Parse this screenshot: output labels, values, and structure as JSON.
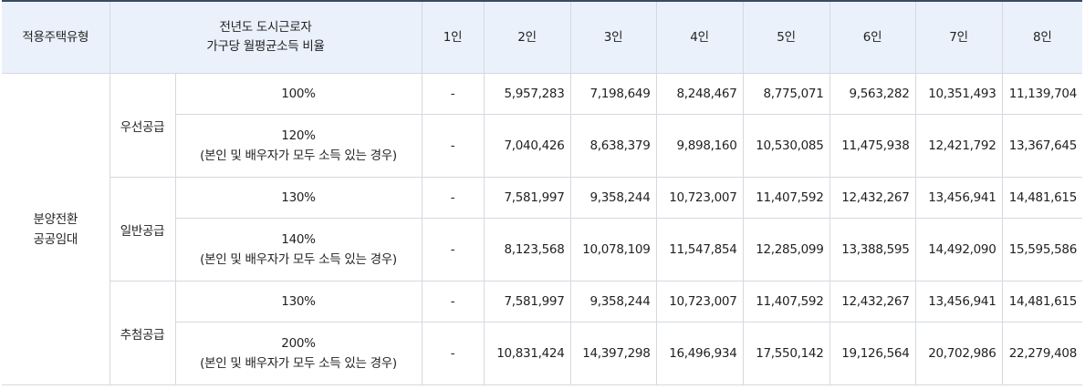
{
  "headers": {
    "type": "적용주택유형",
    "income_ratio_line1": "전년도 도시근로자",
    "income_ratio_line2": "가구당 월평균소득 비율",
    "p1": "1인",
    "p2": "2인",
    "p3": "3인",
    "p4": "4인",
    "p5": "5인",
    "p6": "6인",
    "p7": "7인",
    "p8": "8인"
  },
  "housing_type": {
    "line1": "분양전환",
    "line2": "공공임대"
  },
  "groups": [
    {
      "name": "우선공급",
      "rows": [
        {
          "ratio": "100%",
          "note": "",
          "values": [
            "-",
            "5,957,283",
            "7,198,649",
            "8,248,467",
            "8,775,071",
            "9,563,282",
            "10,351,493",
            "11,139,704"
          ]
        },
        {
          "ratio": "120%",
          "note": "(본인 및 배우자가 모두 소득 있는 경우)",
          "values": [
            "-",
            "7,040,426",
            "8,638,379",
            "9,898,160",
            "10,530,085",
            "11,475,938",
            "12,421,792",
            "13,367,645"
          ]
        }
      ]
    },
    {
      "name": "일반공급",
      "rows": [
        {
          "ratio": "130%",
          "note": "",
          "values": [
            "-",
            "7,581,997",
            "9,358,244",
            "10,723,007",
            "11,407,592",
            "12,432,267",
            "13,456,941",
            "14,481,615"
          ]
        },
        {
          "ratio": "140%",
          "note": "(본인 및 배우자가 모두 소득 있는 경우)",
          "values": [
            "-",
            "8,123,568",
            "10,078,109",
            "11,547,854",
            "12,285,099",
            "13,388,595",
            "14,492,090",
            "15,595,586"
          ]
        }
      ]
    },
    {
      "name": "추첨공급",
      "rows": [
        {
          "ratio": "130%",
          "note": "",
          "values": [
            "-",
            "7,581,997",
            "9,358,244",
            "10,723,007",
            "11,407,592",
            "12,432,267",
            "13,456,941",
            "14,481,615"
          ]
        },
        {
          "ratio": "200%",
          "note": "(본인 및 배우자가 모두 소득 있는 경우)",
          "values": [
            "-",
            "10,831,424",
            "14,397,298",
            "16,496,934",
            "17,550,142",
            "19,126,564",
            "20,702,986",
            "22,279,408"
          ]
        }
      ]
    }
  ]
}
